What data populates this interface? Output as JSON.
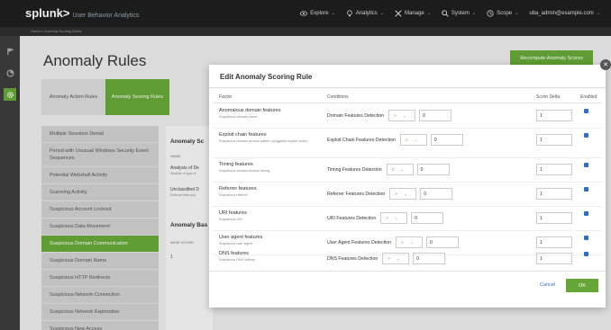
{
  "app": {
    "brand": "splunk>",
    "product": "User Behavior Analytics"
  },
  "topnav": [
    {
      "label": "Explore",
      "icon": "eye-icon"
    },
    {
      "label": "Analytics",
      "icon": "bulb-icon"
    },
    {
      "label": "Manage",
      "icon": "tools-icon"
    },
    {
      "label": "System",
      "icon": "search-icon"
    },
    {
      "label": "Scope",
      "icon": "clock-icon"
    },
    {
      "label": "uba_admin@example.com",
      "icon": ""
    }
  ],
  "breadcrumb": "Home > Anomaly Scoring Rules",
  "page": {
    "title": "Anomaly Rules",
    "recompute_button": "Recompute Anomaly Scores"
  },
  "subtabs": [
    {
      "label": "Anomaly Action Rules",
      "active": false
    },
    {
      "label": "Anomaly Scoring Rules",
      "active": true
    }
  ],
  "rules": [
    "Multiple Sessions Denial",
    "Period with Unusual Windows Security Event Sequences",
    "Potential Webshell Activity",
    "Scanning Activity",
    "Suspicious Account Lockout",
    "Suspicious Data Movement",
    "Suspicious Domain Communication",
    "Suspicious Domain Name",
    "Suspicious HTTP Redirects",
    "Suspicious Network Connection",
    "Suspicious Network Exploration",
    "Suspicious New Access"
  ],
  "background": {
    "section1": "Anomaly Sc",
    "th_name": "NAME",
    "row1": "Analysis of De",
    "row1_sub": "Analysis of type of",
    "row2": "Unclassified D",
    "row2_sub": "External data sour",
    "section2": "Anomaly Bas",
    "th_base": "BASE SCORE",
    "base_value": "1"
  },
  "modal": {
    "title": "Edit Anomaly Scoring Rule",
    "headers": {
      "factor": "Factor",
      "conditions": "Conditions",
      "score_delta": "Score Delta",
      "enabled": "Enabled"
    },
    "rows": [
      {
        "name": "Anomalous domain features",
        "desc": "Suspicious domain name",
        "condition": "Domain Features Detection",
        "op": ">",
        "value": "0",
        "score": "1",
        "enabled": true
      },
      {
        "name": "Exploit chain features",
        "desc": "Suspicious domain access pattern (suggests exploit chain)",
        "condition": "Exploit Chain Features Detection",
        "op": ">",
        "value": "0",
        "score": "1",
        "enabled": true
      },
      {
        "name": "Timing features",
        "desc": "Suspicious domain access timing",
        "condition": "Timing Features Detection",
        "op": ">",
        "value": "0",
        "score": "1",
        "enabled": true
      },
      {
        "name": "Referrer features",
        "desc": "Suspicious referrer",
        "condition": "Referrer Features Detection",
        "op": ">",
        "value": "0",
        "score": "1",
        "enabled": true
      },
      {
        "name": "URI features",
        "desc": "Suspicious URI",
        "condition": "URI Features Detection",
        "op": ">",
        "value": "0",
        "score": "1",
        "enabled": true
      },
      {
        "name": "User agent features",
        "desc": "Suspicious user agent",
        "condition": "User Agent Features Detection",
        "op": ">",
        "value": "0",
        "score": "1",
        "enabled": true
      },
      {
        "name": "DNS features",
        "desc": "Suspicious DNS activity",
        "condition": "DNS Features Detection",
        "op": ">",
        "value": "0",
        "score": "1",
        "enabled": true
      }
    ],
    "cancel": "Cancel",
    "ok": "OK"
  },
  "colors": {
    "accent": "#65a637",
    "link": "#2f6fc9",
    "topbar": "#1e1e1e"
  }
}
